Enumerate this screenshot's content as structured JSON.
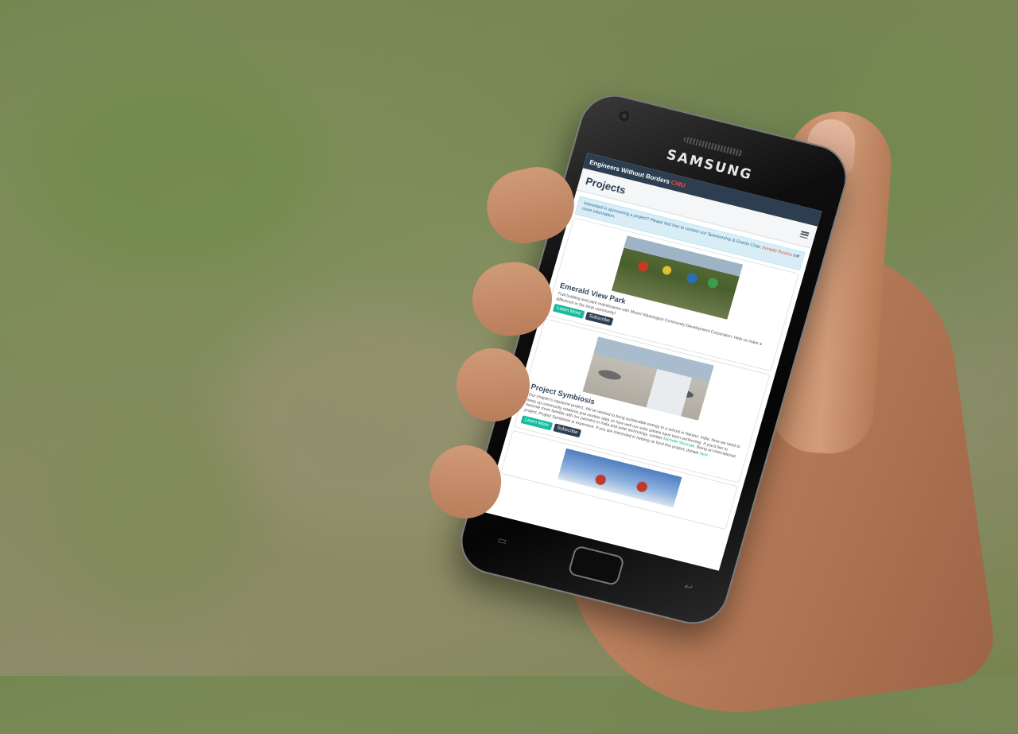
{
  "phone": {
    "brand": "SAMSUNG"
  },
  "app": {
    "site_name": "Engineers Without Borders",
    "site_suffix": "CMU",
    "page_title": "Projects",
    "menu_icon": "hamburger-menu-icon"
  },
  "alert": {
    "text": "Interested in sponsoring a project? Please feel free to contact our Sponsorship & Grants Chair,",
    "link": "Annette Ricchio",
    "suffix": "for more information.",
    "close": "×"
  },
  "projects": [
    {
      "title": "Emerald View Park",
      "description": "Trail building and park maintenance with Mount Washington Community Development Corporation. Help us make a difference in the local community!",
      "learn_more": "Learn More",
      "subscribe": "Subscribe"
    },
    {
      "title": "Project Symbiosis",
      "description": "Our chapter's capstone project. We've worked to bring sustainable energy to a school in Ranpur, India. Now we need to keep up community relations and monitor data on how well our solar panels have been performing. If you'd like to become more familiar with our partners in India and solar technology, contact",
      "link": "Michelle Wozniak",
      "description_after": ". Being an international project, Project Symbiosis is expensive. If you are interested in helping us fund this project, donate",
      "link2": "here",
      "learn_more": "Learn More",
      "subscribe": "Subscribe"
    }
  ]
}
